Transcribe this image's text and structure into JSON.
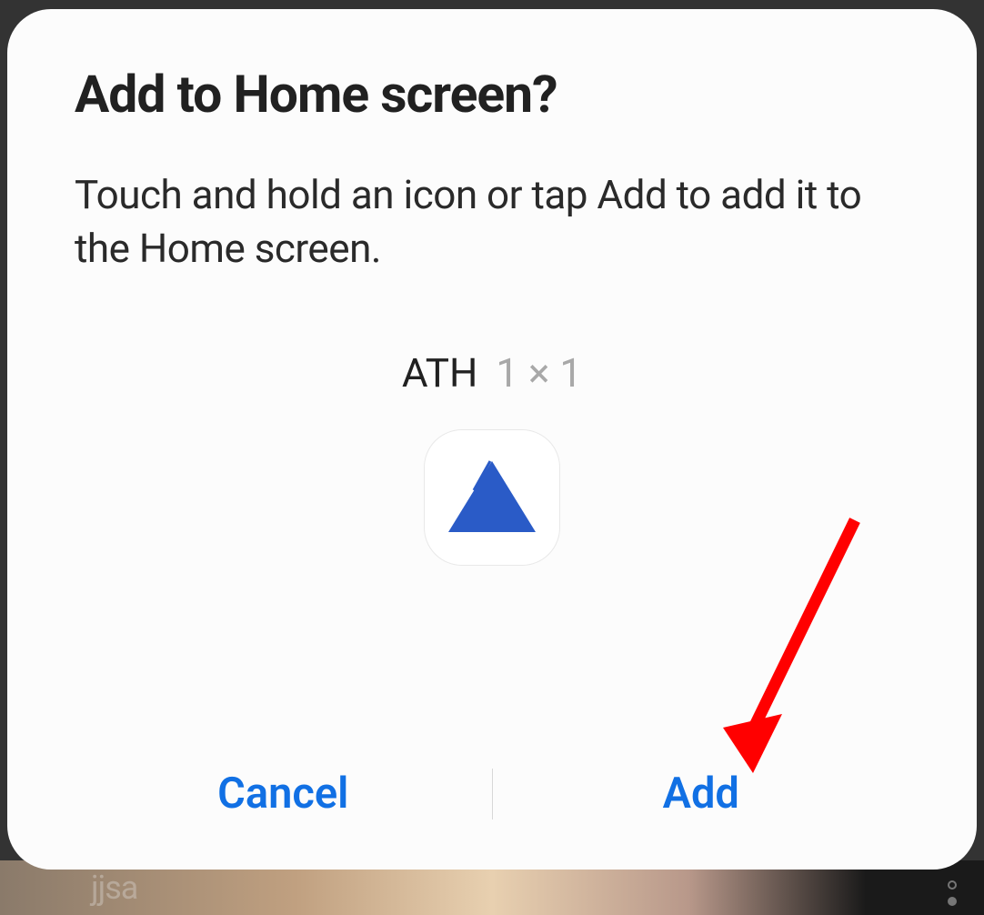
{
  "dialog": {
    "title": "Add to Home screen?",
    "description": "Touch and hold an icon or tap Add to add it to the Home screen.",
    "widget_name": "ATH",
    "widget_size": "1 × 1",
    "cancel_label": "Cancel",
    "add_label": "Add"
  },
  "background": {
    "text": "jjsa"
  }
}
